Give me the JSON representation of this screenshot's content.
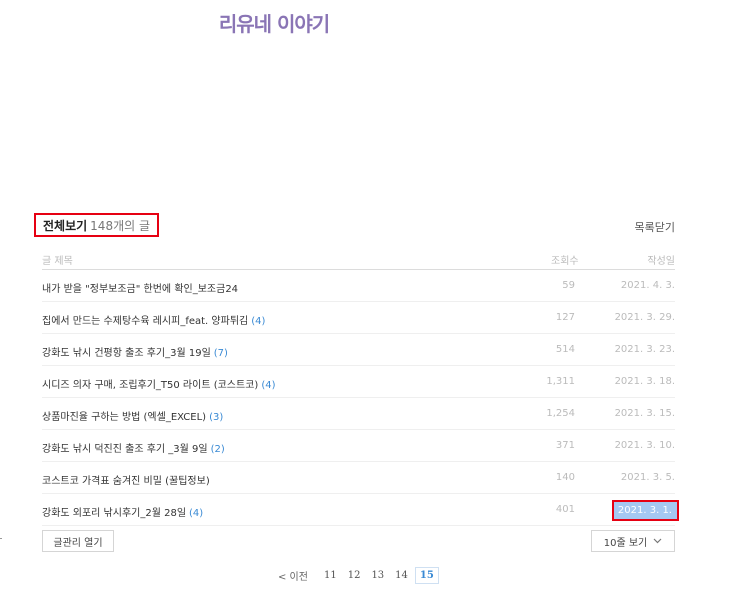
{
  "blog": {
    "title": "리유네 이야기"
  },
  "list": {
    "total_label": "전체보기",
    "total_count": "148개의 글",
    "close_label": "목록닫기",
    "columns": {
      "title": "글 제목",
      "views": "조회수",
      "date": "작성일"
    },
    "rows": [
      {
        "title": "내가 받을 \"정부보조금\" 한번에 확인_보조금24",
        "comments": "",
        "views": "59",
        "date": "2021. 4. 3."
      },
      {
        "title": "집에서 만드는 수제탕수육 레시피_feat. 양파튀김",
        "comments": "(4)",
        "views": "127",
        "date": "2021. 3. 29."
      },
      {
        "title": "강화도 낚시 건평항 출조 후기_3월 19일",
        "comments": "(7)",
        "views": "514",
        "date": "2021. 3. 23."
      },
      {
        "title": "시디즈 의자 구매, 조립후기_T50 라이트 (코스트코)",
        "comments": "(4)",
        "views": "1,311",
        "date": "2021. 3. 18."
      },
      {
        "title": "상품마진율 구하는 방법 (엑셀_EXCEL)",
        "comments": "(3)",
        "views": "1,254",
        "date": "2021. 3. 15."
      },
      {
        "title": "강화도 낚시 덕진진 출조 후기 _3월 9일",
        "comments": "(2)",
        "views": "371",
        "date": "2021. 3. 10."
      },
      {
        "title": "코스트코 가격표 숨겨진 비밀 (꿀팁정보)",
        "comments": "",
        "views": "140",
        "date": "2021. 3. 5."
      },
      {
        "title": "강화도 외포리 낚시후기_2월 28일",
        "comments": "(4)",
        "views": "401",
        "date": "2021. 3. 1."
      }
    ],
    "manage_label": "글관리 열기",
    "per_page_label": "10줄 보기",
    "per_page_icon": "chevron-down-icon"
  },
  "pager": {
    "prev_label": "< 이전",
    "pages": [
      "11",
      "12",
      "13",
      "14"
    ],
    "current": "15"
  },
  "colors": {
    "title_purple": "#8a75b5",
    "link_blue": "#3a8ad4",
    "highlight_red": "#e60012",
    "selection_blue": "#a5c8f2"
  }
}
